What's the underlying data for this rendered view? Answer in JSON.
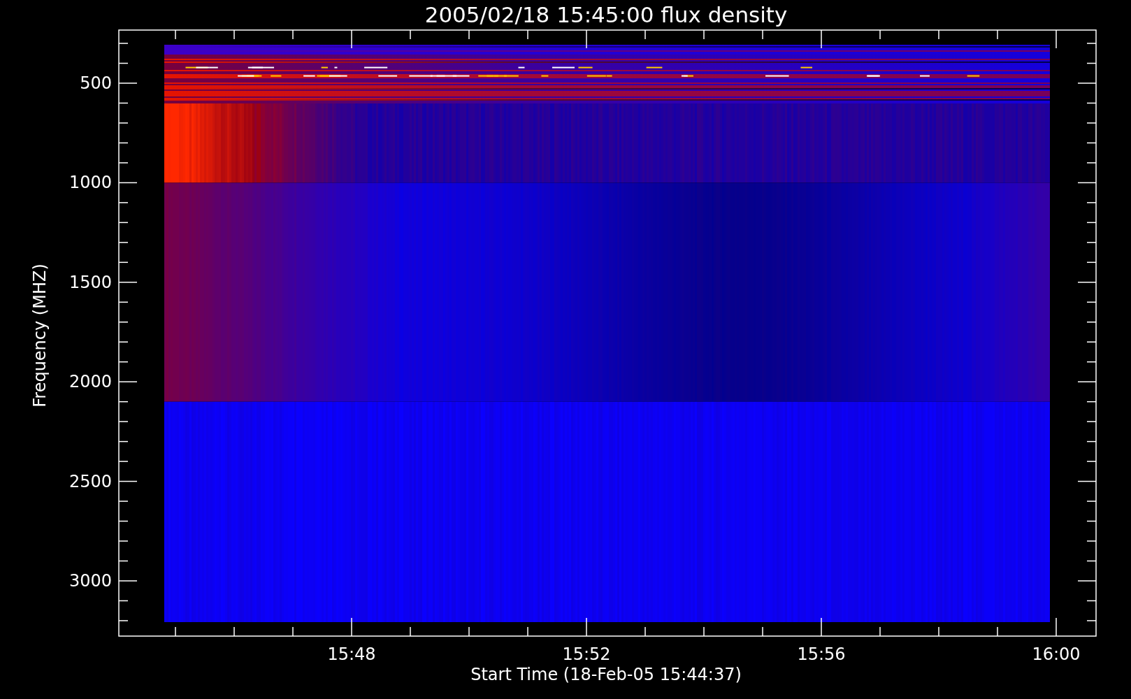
{
  "plot": {
    "title": "2005/02/18 15:45:00 flux density",
    "x_axis": {
      "label": "Start Time (18-Feb-05 15:44:37)",
      "tick_labels": [
        "15:48",
        "15:52",
        "15:56",
        "16:00"
      ]
    },
    "y_axis": {
      "label": "Frequency (MHZ)",
      "tick_labels": [
        "500",
        "1000",
        "1500",
        "2000",
        "2500",
        "3000"
      ]
    }
  }
}
